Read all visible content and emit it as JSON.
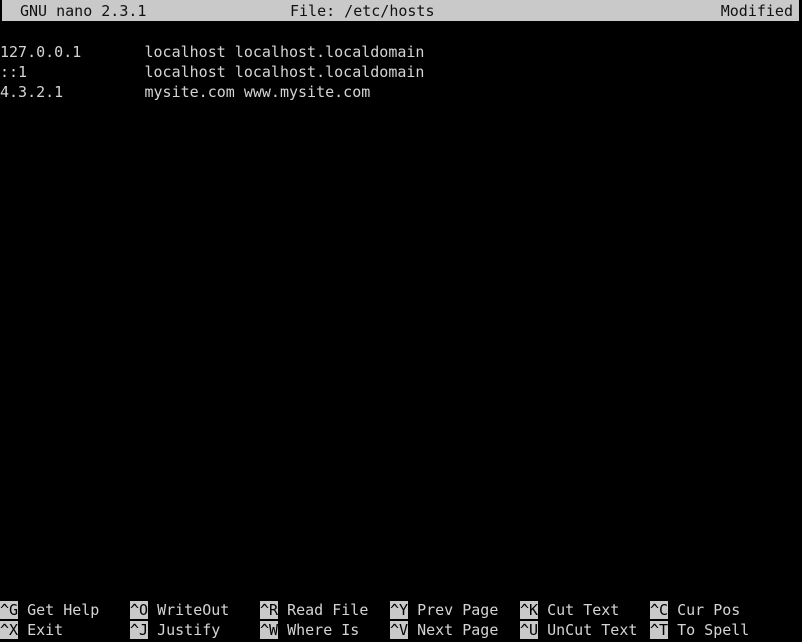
{
  "titlebar": {
    "version": "GNU nano 2.3.1",
    "file": "File: /etc/hosts",
    "status": "Modified"
  },
  "editor": {
    "lines": [
      "127.0.0.1       localhost localhost.localdomain",
      "::1             localhost localhost.localdomain",
      "4.3.2.1         mysite.com www.mysite.com"
    ]
  },
  "shortcuts": {
    "row1": [
      {
        "key": "^G",
        "label": " Get Help"
      },
      {
        "key": "^O",
        "label": " WriteOut"
      },
      {
        "key": "^R",
        "label": " Read File"
      },
      {
        "key": "^Y",
        "label": " Prev Page"
      },
      {
        "key": "^K",
        "label": " Cut Text"
      },
      {
        "key": "^C",
        "label": " Cur Pos"
      }
    ],
    "row2": [
      {
        "key": "^X",
        "label": " Exit"
      },
      {
        "key": "^J",
        "label": " Justify"
      },
      {
        "key": "^W",
        "label": " Where Is"
      },
      {
        "key": "^V",
        "label": " Next Page"
      },
      {
        "key": "^U",
        "label": " UnCut Text"
      },
      {
        "key": "^T",
        "label": " To Spell"
      }
    ]
  },
  "colors": {
    "background": "#000000",
    "foreground": "#d4d4d4",
    "inverse_background": "#c9c9c9",
    "inverse_foreground": "#000000"
  }
}
